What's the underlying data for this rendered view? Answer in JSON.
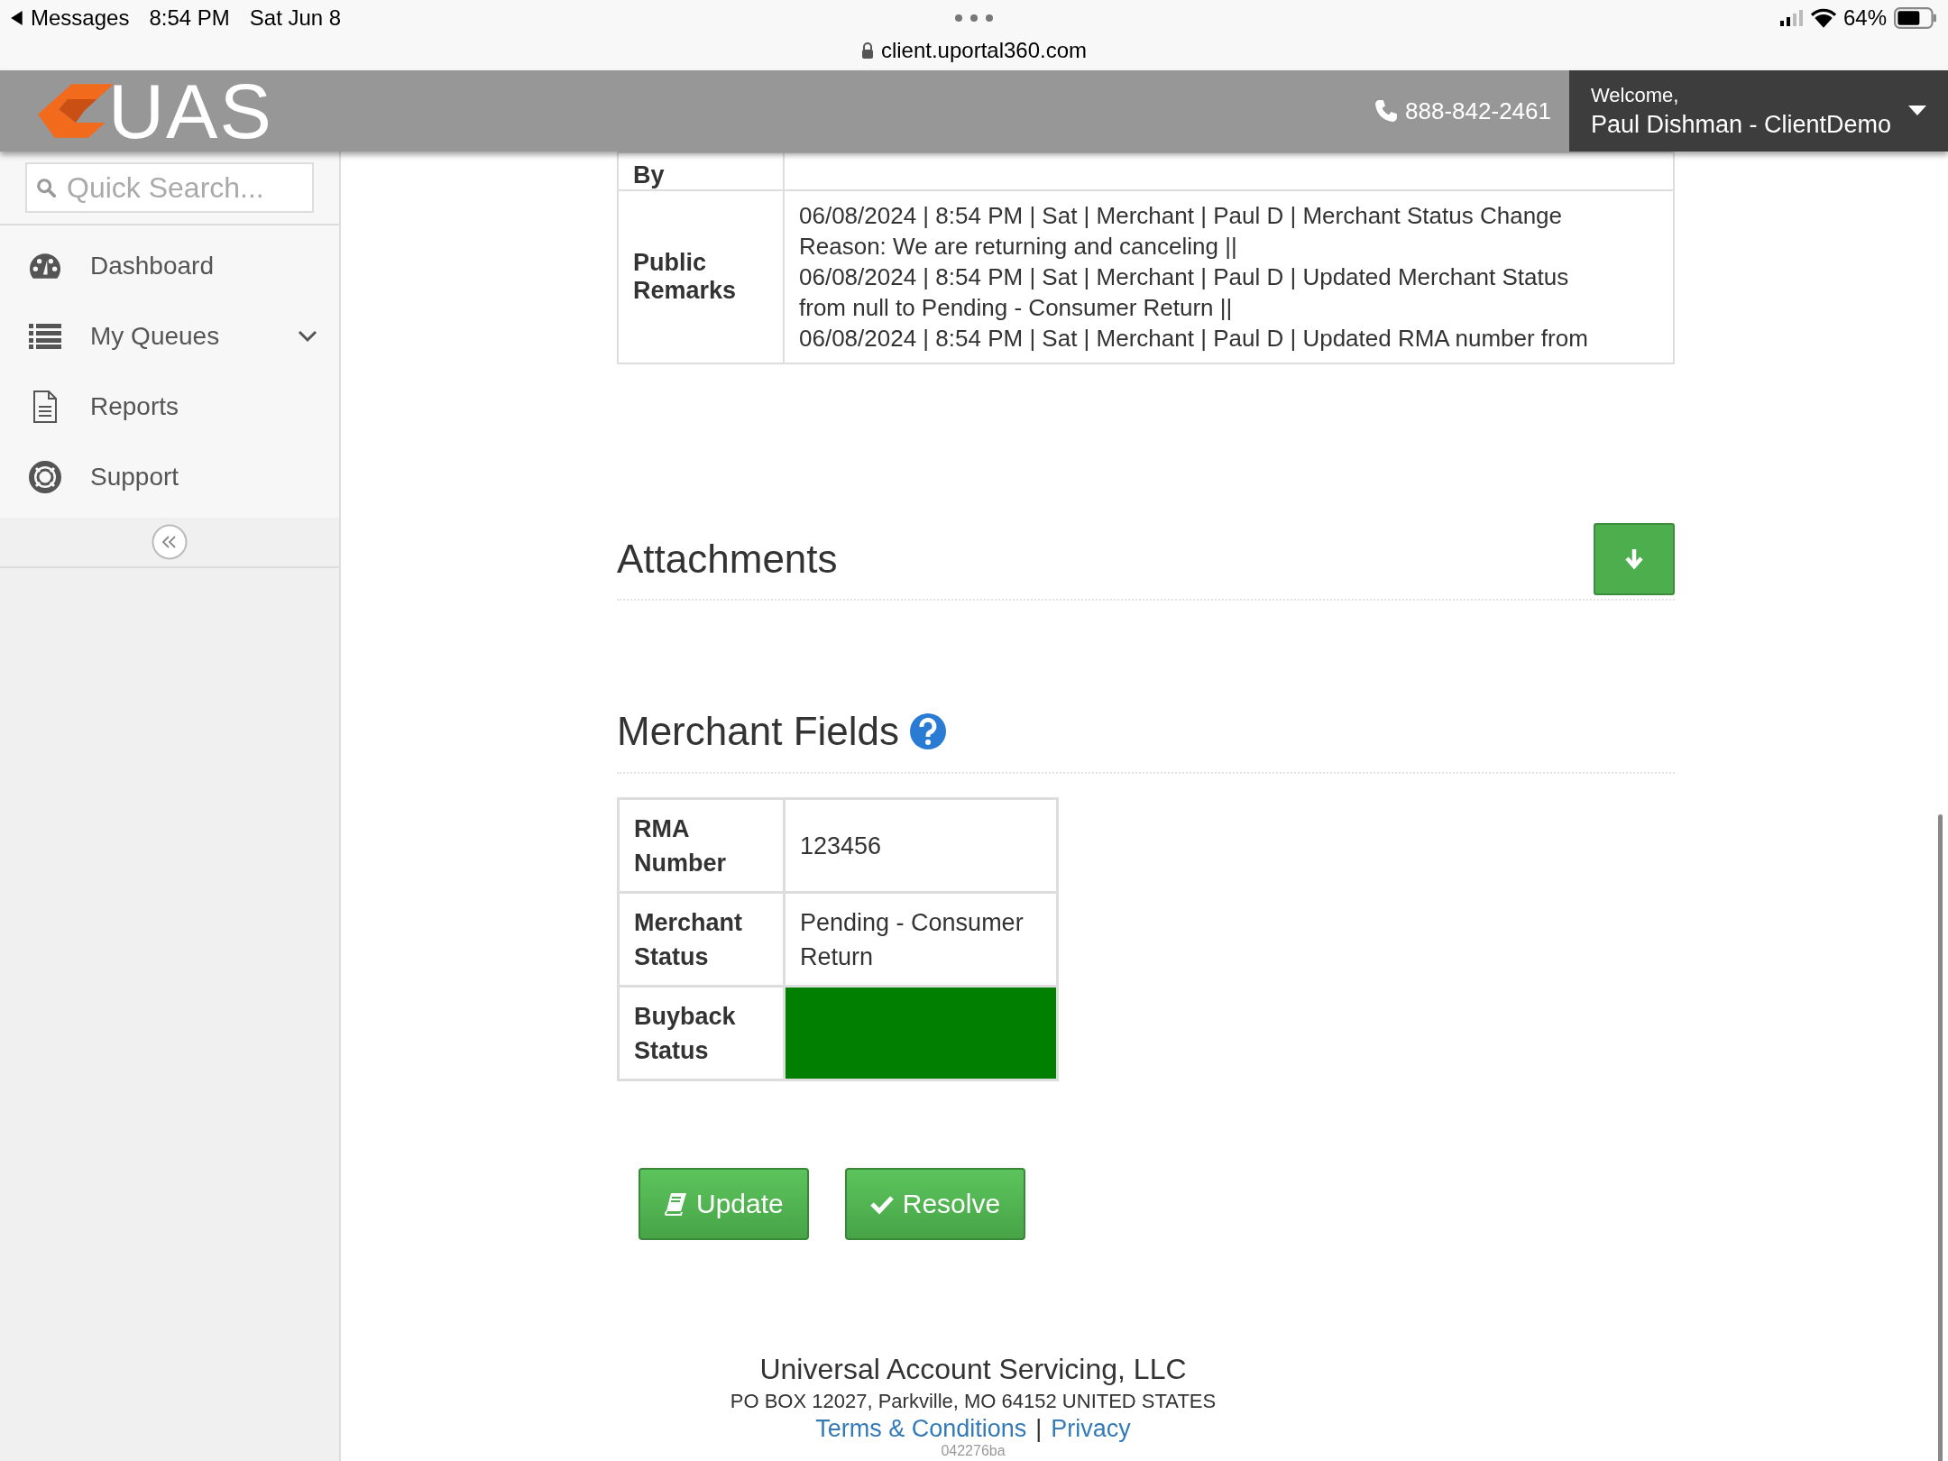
{
  "status_bar": {
    "back_label": "Messages",
    "time": "8:54 PM",
    "date": "Sat Jun 8",
    "url": "client.uportal360.com",
    "battery": "64%"
  },
  "header": {
    "logo": "UAS",
    "phone": "888-842-2461",
    "welcome": "Welcome,",
    "user": "Paul Dishman - ClientDemo"
  },
  "sidebar": {
    "search": {
      "placeholder": "Quick Search..."
    },
    "items": [
      {
        "label": "Dashboard",
        "kind": "dashboard",
        "submenu": false
      },
      {
        "label": "My Queues",
        "kind": "list",
        "submenu": true
      },
      {
        "label": "Reports",
        "kind": "document",
        "submenu": false
      },
      {
        "label": "Support",
        "kind": "support",
        "submenu": false
      }
    ]
  },
  "details": [
    {
      "label": "By"
    },
    {
      "label": "Public Remarks",
      "lines": [
        "06/08/2024 | 8:54 PM | Sat | Merchant | Paul D | Merchant Status Change",
        "Reason: We are returning and canceling ||",
        "06/08/2024 | 8:54 PM | Sat | Merchant | Paul D | Updated Merchant Status",
        "from null to Pending - Consumer Return ||",
        "06/08/2024 | 8:54 PM | Sat | Merchant | Paul D | Updated RMA number from"
      ]
    }
  ],
  "attachments": {
    "title": "Attachments"
  },
  "merchant_fields": {
    "title": "Merchant Fields",
    "rows": [
      {
        "label": "RMA Number",
        "value": "123456"
      },
      {
        "label": "Merchant Status",
        "value": "Pending - Consumer Return"
      },
      {
        "label": "Buyback Status",
        "color": "#007f00"
      }
    ]
  },
  "buttons": [
    {
      "label": "Update",
      "kind": "book"
    },
    {
      "label": "Resolve",
      "kind": "check"
    }
  ],
  "footer": {
    "company": "Universal Account Servicing, LLC",
    "address": "PO BOX 12027, Parkville, MO 64152 UNITED STATES",
    "links": [
      "Terms & Conditions",
      "Privacy"
    ],
    "separator": "|",
    "code": "042276ba"
  }
}
